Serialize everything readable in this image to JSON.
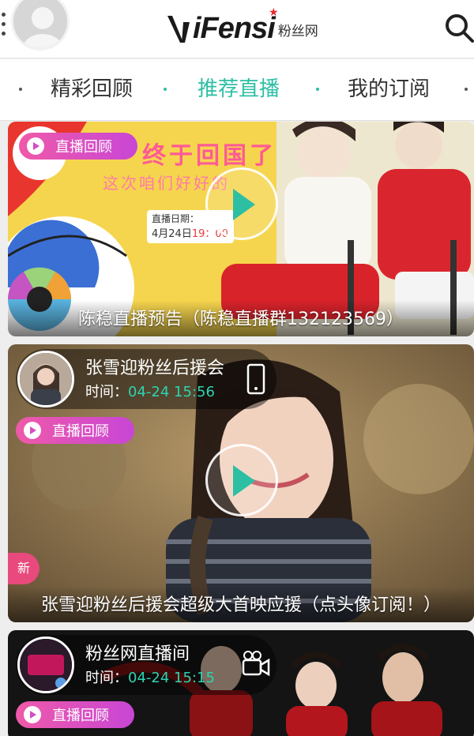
{
  "header": {
    "logo_text": "iFensi",
    "logo_subtitle": "粉丝网"
  },
  "tabs": [
    {
      "label": "精彩回顾",
      "active": false
    },
    {
      "label": "推荐直播",
      "active": true
    },
    {
      "label": "我的订阅",
      "active": false
    }
  ],
  "colors": {
    "accent": "#2dbfa4",
    "replay_badge_start": "#ef5aa8",
    "replay_badge_end": "#c846d6",
    "time_text": "#2dd4b0"
  },
  "cards": [
    {
      "badge": "直播回顾",
      "poster_title": "终于回国了",
      "poster_subtitle": "这次咱们好好的",
      "date_label": "直播日期：",
      "date_value": "4月24日",
      "date_time": "19：00",
      "caption": "陈稳直播预告（陈稳直播群132123569）"
    },
    {
      "badge": "直播回顾",
      "host_name": "张雪迎粉丝后援会",
      "time_label": "时间：",
      "time_value": "04-24 15:56",
      "device_icon": "phone-icon",
      "new_label": "新",
      "caption": "张雪迎粉丝后援会超级大首映应援（点头像订阅！）"
    },
    {
      "badge": "直播回顾",
      "host_name": "粉丝网直播间",
      "time_label": "时间：",
      "time_value": "04-24 15:15",
      "device_icon": "video-camera-icon"
    }
  ]
}
